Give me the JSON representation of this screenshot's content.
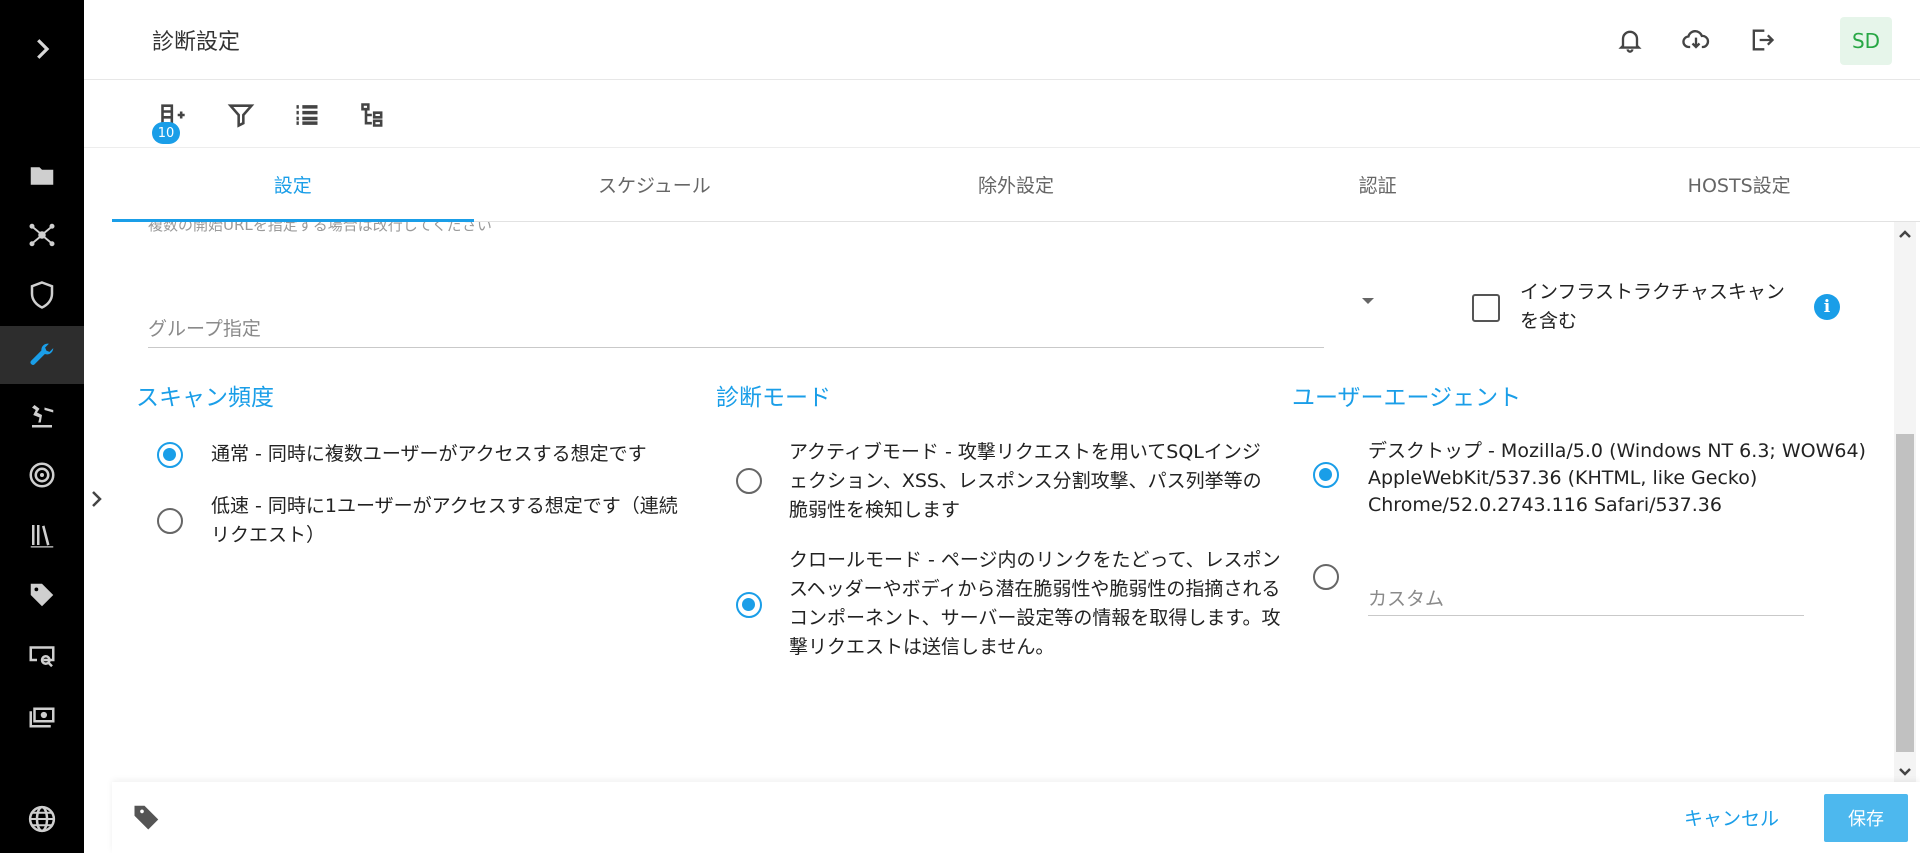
{
  "header": {
    "title": "診断設定",
    "avatar": "SD",
    "icons": [
      "bell-icon",
      "cloud-download-icon",
      "logout-icon"
    ]
  },
  "toolbar": {
    "badge_count": "10",
    "icons": [
      "add-list-icon",
      "filter-icon",
      "list-icon",
      "tree-icon"
    ]
  },
  "tabs": [
    {
      "label": "設定",
      "active": true
    },
    {
      "label": "スケジュール"
    },
    {
      "label": "除外設定"
    },
    {
      "label": "認証"
    },
    {
      "label": "HOSTS設定"
    }
  ],
  "form": {
    "cut_hint": "複数の開始URLを指定する場合は改行してください",
    "group_placeholder": "グループ指定",
    "infra_scan_label": "インフラストラクチャスキャンを含む",
    "info_icon": "i"
  },
  "scan_frequency": {
    "title": "スキャン頻度",
    "options": [
      {
        "label": "通常 - 同時に複数ユーザーがアクセスする想定です",
        "selected": true
      },
      {
        "label": "低速 - 同時に1ユーザーがアクセスする想定です（連続リクエスト）",
        "selected": false
      }
    ]
  },
  "diagnostic_mode": {
    "title": "診断モード",
    "options": [
      {
        "label": "アクティブモード - 攻撃リクエストを用いてSQLインジェクション、XSS、レスポンス分割攻撃、パス列挙等の脆弱性を検知します",
        "selected": false
      },
      {
        "label": "クロールモード - ページ内のリンクをたどって、レスポンスヘッダーやボディから潜在脆弱性や脆弱性の指摘されるコンポーネント、サーバー設定等の情報を取得します。攻撃リクエストは送信しません。",
        "selected": true
      }
    ]
  },
  "user_agent": {
    "title": "ユーザーエージェント",
    "options": [
      {
        "label": "デスクトップ - Mozilla/5.0 (Windows NT 6.3; WOW64) AppleWebKit/537.36 (KHTML, like Gecko) Chrome/52.0.2743.116 Safari/537.36",
        "selected": true
      },
      {
        "label": "",
        "selected": false
      }
    ],
    "custom_placeholder": "カスタム"
  },
  "footer": {
    "cancel_label": "キャンセル",
    "save_label": "保存"
  },
  "colors": {
    "accent": "#1a9ee8",
    "rail": "#000000",
    "save_button": "#4db8ee"
  }
}
